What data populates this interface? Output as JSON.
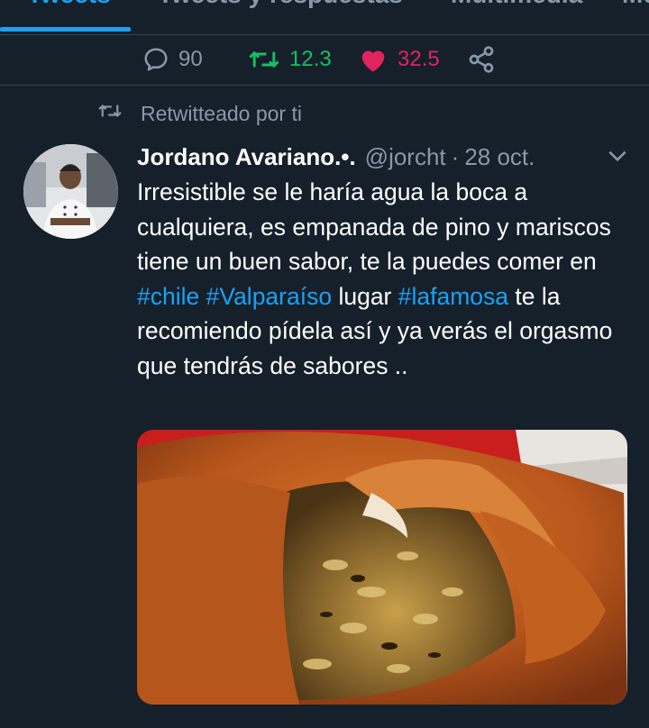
{
  "tabs": [
    {
      "label": "Tweets",
      "active": true
    },
    {
      "label": "Tweets y respuestas",
      "active": false
    },
    {
      "label": "Multimedia",
      "active": false
    },
    {
      "label": "Me gusta",
      "active": false
    }
  ],
  "prev_tweet_actions": {
    "replies": "90",
    "retweets": "12.3",
    "likes": "32.5",
    "retweet_color": "#17bf63",
    "like_color": "#e0245e"
  },
  "tweet": {
    "retweet_context": "Retwitteado por ti",
    "author_name": "Jordano Avariano.•.",
    "handle": "@jorcht",
    "separator": "·",
    "date": "28 oct.",
    "text_parts": [
      {
        "text": "Irresistible se le haría agua la boca a cualquiera, es empanada de pino y mariscos tiene un buen sabor, te la puedes comer en ",
        "link": false
      },
      {
        "text": "#chile",
        "link": true
      },
      {
        "text": " ",
        "link": false
      },
      {
        "text": "#Valparaíso",
        "link": true
      },
      {
        "text": " lugar ",
        "link": false
      },
      {
        "text": "#lafamosa",
        "link": true
      },
      {
        "text": " te la recomiendo pídela así y ya verás el orgasmo que tendrás de sabores ..",
        "link": false
      }
    ],
    "avatar_icon": "chef-avatar",
    "media_icon": "empanada-photo"
  },
  "colors": {
    "background": "#15202b",
    "divider": "#38444d",
    "secondary_text": "#8899a6",
    "accent": "#1da1f2"
  }
}
